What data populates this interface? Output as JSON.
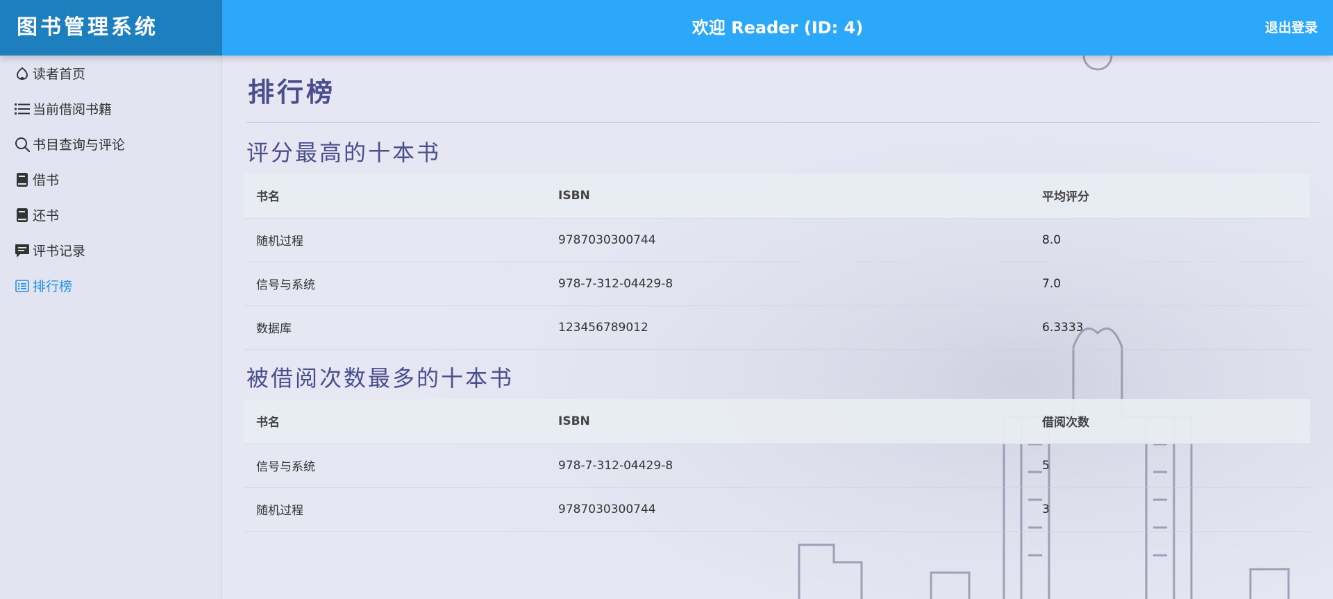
{
  "header": {
    "brand": "图书管理系统",
    "welcome": "欢迎 Reader (ID: 4)",
    "logout": "退出登录",
    "bg_color": "#2ca8fb",
    "brand_bg_color": "#1e7fbf"
  },
  "sidebar": {
    "items": [
      {
        "label": "读者首页",
        "icon": "home-icon"
      },
      {
        "label": "当前借阅书籍",
        "icon": "list-icon"
      },
      {
        "label": "书目查询与评论",
        "icon": "search-icon"
      },
      {
        "label": "借书",
        "icon": "book-icon"
      },
      {
        "label": "还书",
        "icon": "book-icon"
      },
      {
        "label": "评书记录",
        "icon": "comment-icon"
      },
      {
        "label": "排行榜",
        "icon": "ranking-icon",
        "active": true
      }
    ],
    "active_color": "#2290e6"
  },
  "main": {
    "title": "排行榜",
    "top_rated": {
      "title": "评分最高的十本书",
      "headers": [
        "书名",
        "ISBN",
        "平均评分"
      ],
      "rows": [
        [
          "随机过程",
          "9787030300744",
          "8.0"
        ],
        [
          "信号与系统",
          "978-7-312-04429-8",
          "7.0"
        ],
        [
          "数据库",
          "123456789012",
          "6.3333"
        ]
      ]
    },
    "most_borrowed": {
      "title": "被借阅次数最多的十本书",
      "headers": [
        "书名",
        "ISBN",
        "借阅次数"
      ],
      "rows": [
        [
          "信号与系统",
          "978-7-312-04429-8",
          "5"
        ],
        [
          "随机过程",
          "9787030300744",
          "3"
        ]
      ]
    }
  }
}
